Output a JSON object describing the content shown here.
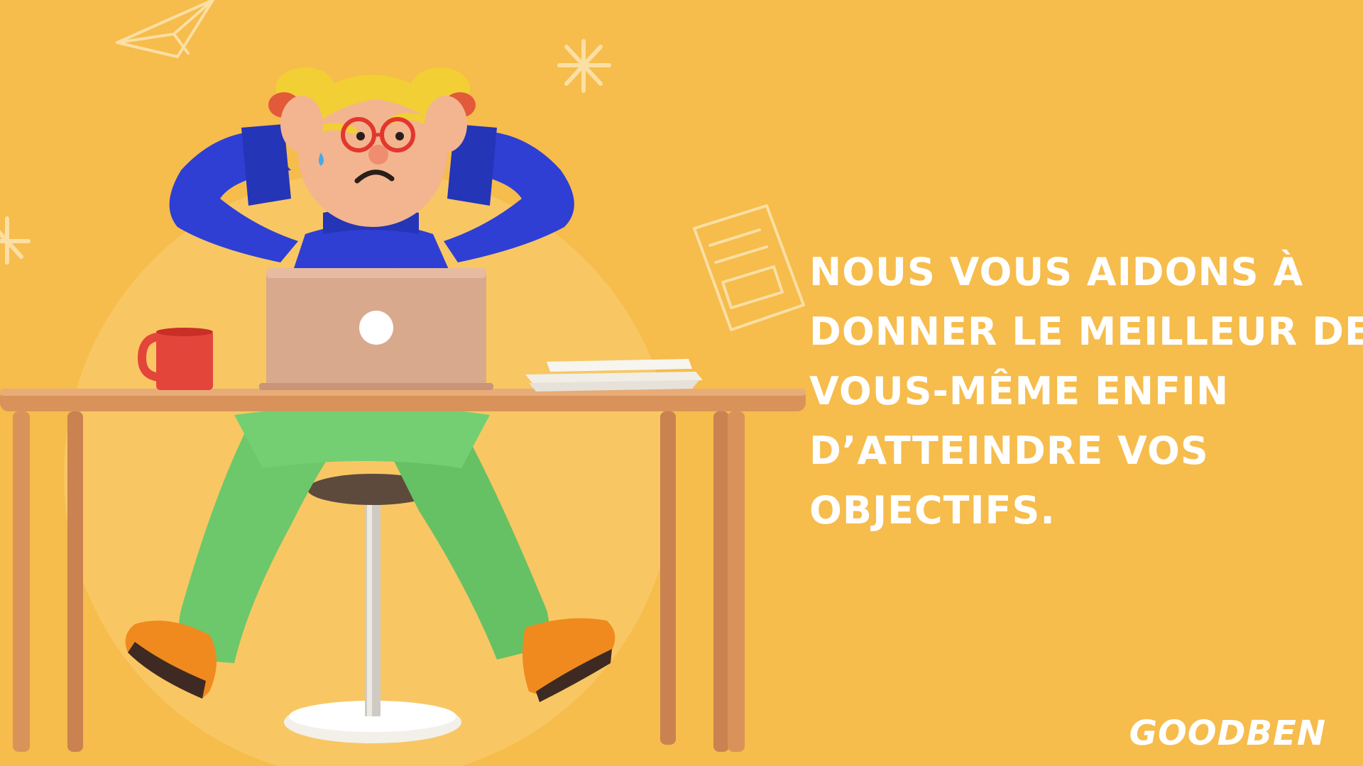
{
  "headline": {
    "lines": [
      "NOUS VOUS AIDONS À",
      "DONNER LE MEILLEUR DE",
      "VOUS-MÊME ENFIN",
      "D’ATTEINDRE VOS",
      "OBJECTIFS."
    ]
  },
  "brand": {
    "logo_text": "GOODBEN"
  },
  "colors": {
    "background": "#F6BC4C",
    "text": "#FFFFFF",
    "sweater": "#2F3FD3",
    "pants": "#6CC86A",
    "shoes": "#F08A1E",
    "mug": "#E3453B",
    "hair": "#F2CF34",
    "desk": "#D9935A",
    "laptop": "#D9A98D"
  },
  "illustration": {
    "subject": "stressed-person-at-desk",
    "decorations": [
      "paper-plane-doodle",
      "asterisk-doodle",
      "document-doodle",
      "asterisk-doodle-left"
    ]
  }
}
